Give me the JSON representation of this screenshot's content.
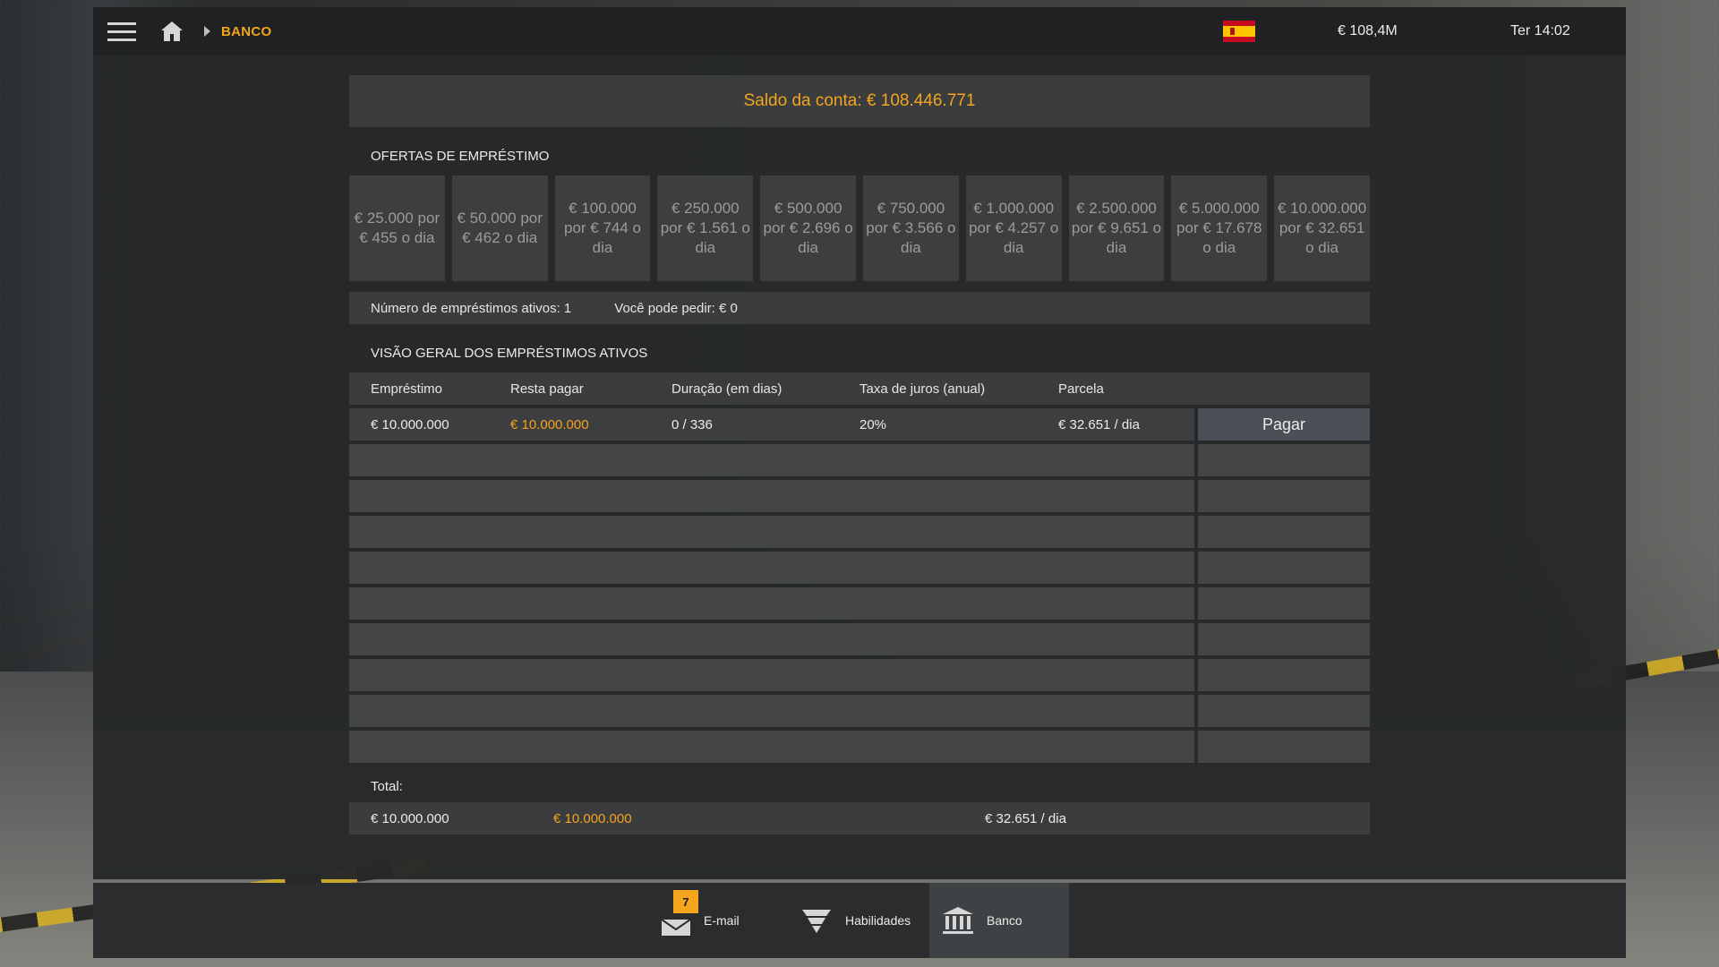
{
  "topbar": {
    "breadcrumb": "BANCO",
    "money": "€ 108,4M",
    "clock": "Ter 14:02",
    "menu_icon": "hamburger-menu-icon",
    "home_icon": "home-icon",
    "flag_icon": "spain-flag-icon"
  },
  "balance": "Saldo da conta: € 108.446.771",
  "offers_title": "OFERTAS DE EMPRÉSTIMO",
  "offers": [
    {
      "label": "€ 25.000 por € 455 o dia"
    },
    {
      "label": "€ 50.000 por € 462 o dia"
    },
    {
      "label": "€ 100.000 por € 744 o dia"
    },
    {
      "label": "€ 250.000 por € 1.561 o dia"
    },
    {
      "label": "€ 500.000 por € 2.696 o dia"
    },
    {
      "label": "€ 750.000 por € 3.566 o dia"
    },
    {
      "label": "€ 1.000.000 por € 4.257 o dia"
    },
    {
      "label": "€ 2.500.000 por € 9.651 o dia"
    },
    {
      "label": "€ 5.000.000 por € 17.678 o dia"
    },
    {
      "label": "€ 10.000.000 por € 32.651 o dia"
    }
  ],
  "info": {
    "active_loans": "Número de empréstimos ativos: 1",
    "can_borrow": "Você pode pedir: € 0"
  },
  "overview_title": "VISÃO GERAL DOS EMPRÉSTIMOS ATIVOS",
  "table": {
    "headers": [
      "Empréstimo",
      "Resta pagar",
      "Duração (em dias)",
      "Taxa de juros (anual)",
      "Parcela"
    ],
    "row": {
      "loan": "€ 10.000.000",
      "remaining": "€ 10.000.000",
      "duration": "0 / 336",
      "rate": "20%",
      "installment": "€ 32.651 / dia",
      "pay_label": "Pagar"
    }
  },
  "total": {
    "label": "Total:",
    "loan": "€ 10.000.000",
    "remaining": "€ 10.000.000",
    "installment": "€ 32.651 / dia"
  },
  "dock": {
    "email_label": "E-mail",
    "email_badge": "7",
    "skills_label": "Habilidades",
    "bank_label": "Banco"
  },
  "colors": {
    "accent": "#f3a51d",
    "panel": "#262829",
    "button": "#4b5057"
  }
}
